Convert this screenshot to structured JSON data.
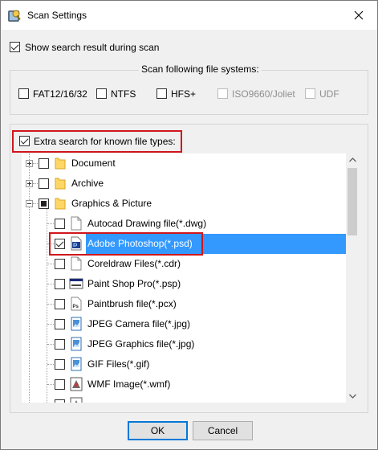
{
  "window": {
    "title": "Scan Settings",
    "icons": {
      "app": "scan-settings-app-icon",
      "close": "close-icon"
    }
  },
  "options": {
    "show_search_result": {
      "label": "Show search result during scan",
      "checked": true
    }
  },
  "file_systems": {
    "caption": "Scan following file systems:",
    "items": [
      {
        "label": "FAT12/16/32",
        "checked": false,
        "enabled": true
      },
      {
        "label": "NTFS",
        "checked": false,
        "enabled": true
      },
      {
        "label": "HFS+",
        "checked": false,
        "enabled": true
      },
      {
        "label": "ISO9660/Joliet",
        "checked": false,
        "enabled": false
      },
      {
        "label": "UDF",
        "checked": false,
        "enabled": false
      }
    ]
  },
  "extra_search": {
    "label": "Extra search for known file types:",
    "checked": true,
    "tree": [
      {
        "label": "Document",
        "type": "category",
        "expanded": false,
        "state": "unchecked",
        "icon": "folder-icon"
      },
      {
        "label": "Archive",
        "type": "category",
        "expanded": false,
        "state": "unchecked",
        "icon": "folder-icon"
      },
      {
        "label": "Graphics & Picture",
        "type": "category",
        "expanded": true,
        "state": "partial",
        "icon": "folder-icon"
      },
      {
        "label": "Autocad Drawing file(*.dwg)",
        "type": "file",
        "state": "unchecked",
        "icon": "blank-document-icon"
      },
      {
        "label": "Adobe Photoshop(*.psd)",
        "type": "file",
        "state": "checked",
        "selected": true,
        "icon": "photoshop-file-icon"
      },
      {
        "label": "Coreldraw Files(*.cdr)",
        "type": "file",
        "state": "unchecked",
        "icon": "blank-document-icon"
      },
      {
        "label": "Paint Shop Pro(*.psp)",
        "type": "file",
        "state": "unchecked",
        "icon": "paint-shop-pro-icon"
      },
      {
        "label": "Paintbrush file(*.pcx)",
        "type": "file",
        "state": "unchecked",
        "icon": "paintbrush-file-icon"
      },
      {
        "label": "JPEG Camera file(*.jpg)",
        "type": "file",
        "state": "unchecked",
        "icon": "image-file-icon"
      },
      {
        "label": "JPEG Graphics file(*.jpg)",
        "type": "file",
        "state": "unchecked",
        "icon": "image-file-icon"
      },
      {
        "label": "GIF Files(*.gif)",
        "type": "file",
        "state": "unchecked",
        "icon": "image-file-icon"
      },
      {
        "label": "WMF Image(*.wmf)",
        "type": "file",
        "state": "unchecked",
        "icon": "wmf-image-icon"
      },
      {
        "label": "",
        "type": "file",
        "state": "unchecked",
        "icon": "wmf-image-icon",
        "partially_visible": true
      }
    ]
  },
  "buttons": {
    "ok": "OK",
    "cancel": "Cancel"
  },
  "colors": {
    "selection": "#3399ff",
    "highlight_border": "#d0161c",
    "default_button_border": "#0078d7",
    "folder": "#ffd766"
  }
}
